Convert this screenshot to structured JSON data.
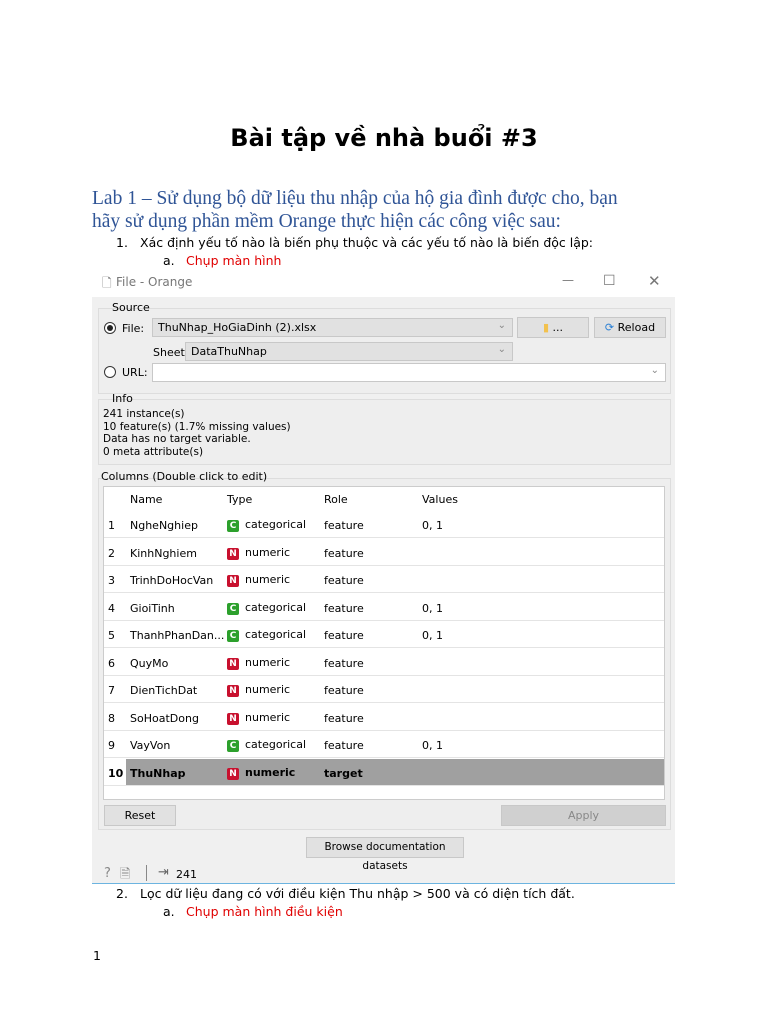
{
  "doc": {
    "title": "Bài tập về nhà buổi #3",
    "lab_line1": "Lab 1 – Sử dụng bộ dữ liệu thu nhập của hộ gia đình được cho, bạn",
    "lab_line2": "hãy sử dụng phần mềm Orange thực hiện các công việc sau:",
    "item1_num": "1.",
    "item1": "Xác định yếu tố nào là biến phụ thuộc và các yếu tố nào là biến độc lập:",
    "item1a_num": "a.",
    "item1a": "Chụp màn hình",
    "item2_num": "2.",
    "item2": "Lọc dữ liệu đang có với điều kiện Thu nhập > 500 và có diện tích đất.",
    "item2a_num": "a.",
    "item2a": "Chụp màn hình điều kiện",
    "page_number": "1"
  },
  "window": {
    "title": "File - Orange",
    "source_label": "Source",
    "file_label": "File:",
    "file_value": "ThuNhap_HoGiaDinh (2).xlsx",
    "browse_label": "...",
    "reload_label": "Reload",
    "sheet_label": "Sheet",
    "sheet_value": "DataThuNhap",
    "url_label": "URL:",
    "url_value": "",
    "info_label": "Info",
    "info_lines": [
      "241 instance(s)",
      "10 feature(s) (1.7% missing values)",
      "Data has no target variable.",
      "0 meta attribute(s)"
    ],
    "columns_label": "Columns (Double click to edit)",
    "headers": [
      "Name",
      "Type",
      "Role",
      "Values"
    ],
    "rows": [
      {
        "n": "1",
        "name": "NgheNghiep",
        "tc": "C",
        "type": "categorical",
        "role": "feature",
        "values": "0, 1"
      },
      {
        "n": "2",
        "name": "KinhNghiem",
        "tc": "N",
        "type": "numeric",
        "role": "feature",
        "values": ""
      },
      {
        "n": "3",
        "name": "TrinhDoHocVan",
        "tc": "N",
        "type": "numeric",
        "role": "feature",
        "values": ""
      },
      {
        "n": "4",
        "name": "GioiTinh",
        "tc": "C",
        "type": "categorical",
        "role": "feature",
        "values": "0, 1"
      },
      {
        "n": "5",
        "name": "ThanhPhanDan...",
        "tc": "C",
        "type": "categorical",
        "role": "feature",
        "values": "0, 1"
      },
      {
        "n": "6",
        "name": "QuyMo",
        "tc": "N",
        "type": "numeric",
        "role": "feature",
        "values": ""
      },
      {
        "n": "7",
        "name": "DienTichDat",
        "tc": "N",
        "type": "numeric",
        "role": "feature",
        "values": ""
      },
      {
        "n": "8",
        "name": "SoHoatDong",
        "tc": "N",
        "type": "numeric",
        "role": "feature",
        "values": ""
      },
      {
        "n": "9",
        "name": "VayVon",
        "tc": "C",
        "type": "categorical",
        "role": "feature",
        "values": "0, 1"
      },
      {
        "n": "10",
        "name": "ThuNhap",
        "tc": "N",
        "type": "numeric",
        "role": "target",
        "values": ""
      }
    ],
    "reset_label": "Reset",
    "apply_label": "Apply",
    "browse_docs_label": "Browse documentation datasets",
    "output_count": "241",
    "colors": {
      "categorical": "#2ca02c",
      "numeric": "#c8102e",
      "selected_row": "#a0a0a0"
    }
  }
}
